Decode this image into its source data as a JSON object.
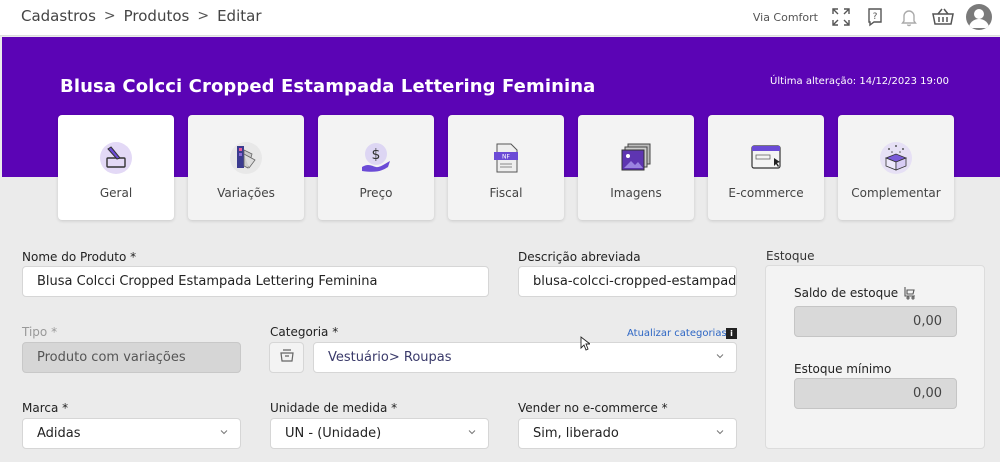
{
  "breadcrumb": [
    "Cadastros",
    "Produtos",
    "Editar"
  ],
  "header": {
    "store_label": "Via Comfort"
  },
  "product": {
    "title": "Blusa Colcci Cropped Estampada Lettering Feminina",
    "last_update": "Última alteração: 14/12/2023 19:00"
  },
  "tabs": [
    {
      "label": "Geral",
      "icon": "pencil-board-icon"
    },
    {
      "label": "Variações",
      "icon": "color-swatches-icon"
    },
    {
      "label": "Preço",
      "icon": "dollar-hand-icon"
    },
    {
      "label": "Fiscal",
      "icon": "nf-document-icon"
    },
    {
      "label": "Imagens",
      "icon": "image-stack-icon"
    },
    {
      "label": "E-commerce",
      "icon": "web-window-icon"
    },
    {
      "label": "Complementar",
      "icon": "gift-box-icon"
    }
  ],
  "form": {
    "nome_label": "Nome do Produto *",
    "nome_value": "Blusa Colcci Cropped Estampada Lettering Feminina",
    "descricao_label": "Descrição abreviada",
    "descricao_value": "blusa-colcci-cropped-estampada-lettering-feminina",
    "tipo_label": "Tipo *",
    "tipo_value": "Produto com variações",
    "categoria_label": "Categoria *",
    "categoria_link": "Atualizar categorias",
    "categoria_info": "i",
    "categoria_value": "Vestuário> Roupas",
    "marca_label": "Marca *",
    "marca_value": "Adidas",
    "unidade_label": "Unidade de medida *",
    "unidade_value": "UN - (Unidade)",
    "vender_label": "Vender no e-commerce *",
    "vender_value": "Sim, liberado"
  },
  "estoque": {
    "title": "Estoque",
    "saldo_label": "Saldo de estoque",
    "saldo_value": "0,00",
    "minimo_label": "Estoque mínimo",
    "minimo_value": "0,00"
  },
  "colors": {
    "brand": "#5b04b5",
    "link": "#2d66c4"
  }
}
